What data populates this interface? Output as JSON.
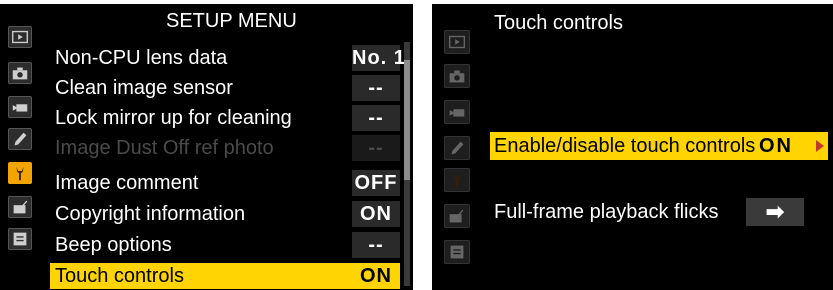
{
  "left_screen": {
    "title": "SETUP MENU",
    "rows": [
      {
        "label": "Non-CPU lens data",
        "value": "No. 1"
      },
      {
        "label": "Clean image sensor",
        "value": "--"
      },
      {
        "label": "Lock mirror up for cleaning",
        "value": "--"
      },
      {
        "label": "Image Dust Off ref photo",
        "value": "--"
      },
      {
        "label": "Image comment",
        "value": "OFF"
      },
      {
        "label": "Copyright information",
        "value": "ON"
      },
      {
        "label": "Beep options",
        "value": "--"
      },
      {
        "label": "Touch controls",
        "value": "ON"
      }
    ]
  },
  "right_screen": {
    "title": "Touch controls",
    "rows": [
      {
        "label": "Enable/disable touch controls",
        "value": "ON"
      },
      {
        "label": "Full-frame playback flicks",
        "value": "➡"
      }
    ]
  },
  "sidebar_icons": [
    "playback-icon",
    "camera-icon",
    "movie-icon",
    "pencil-icon",
    "wrench-icon",
    "retouch-icon",
    "my-menu-icon"
  ],
  "colors": {
    "highlight": "#ffd400",
    "active_tab": "#f2a400",
    "background": "#000000"
  }
}
